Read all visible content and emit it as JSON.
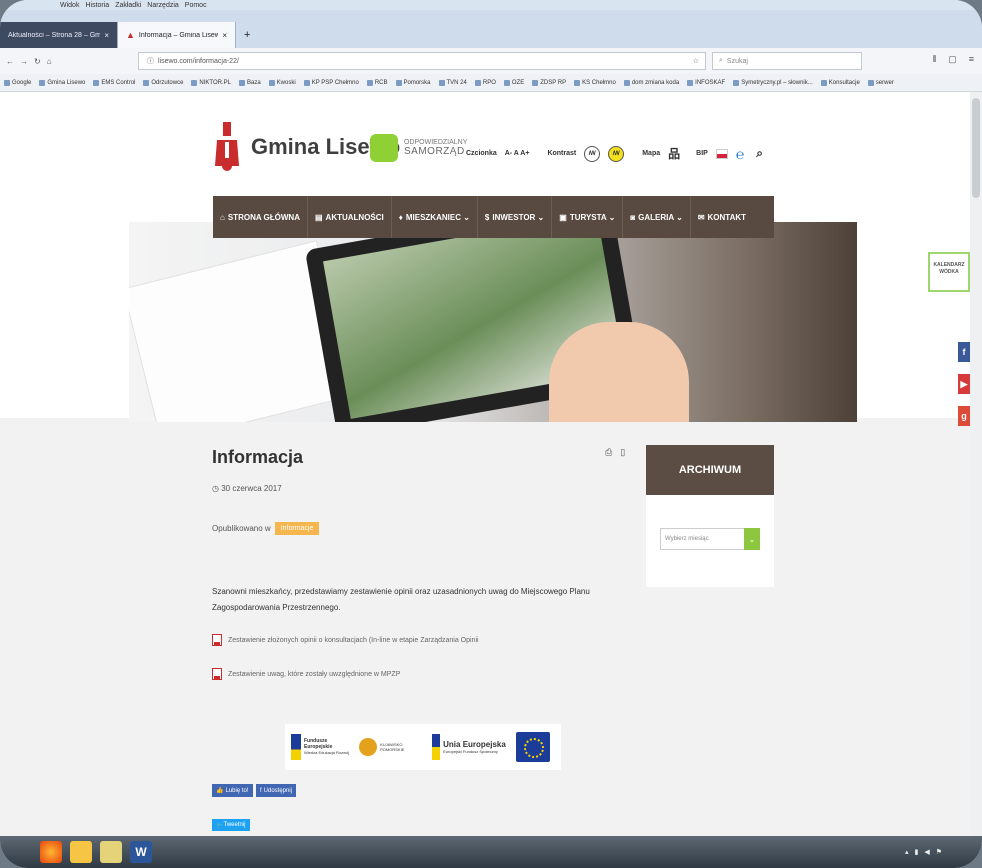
{
  "browser": {
    "menu": [
      "Widok",
      "Historia",
      "Zakładki",
      "Narzędzia",
      "Pomoc"
    ],
    "tabs": [
      {
        "label": "Aktualności – Strona 28 – Gmi...",
        "active": false
      },
      {
        "label": "Informacja – Gmina Lisewo",
        "active": true
      }
    ],
    "url": "lisewo.com/informacja-22/",
    "search_placeholder": "Szukaj",
    "bookmarks": [
      "Google",
      "Gmina Lisewo",
      "EMS Control",
      "Odrzutowce",
      "NIKTOR.PL",
      "Baza",
      "Kwoski",
      "KP PSP Chełmno",
      "RCB",
      "Pomorska",
      "TVN 24",
      "RPO",
      "OZE",
      "ZDSP RP",
      "KS Chełmno",
      "dom zmiana koda",
      "INFOSKAF",
      "Symetryczny.pl – słownik...",
      "Konsultacje",
      "serwer"
    ]
  },
  "site": {
    "title": "Gmina Lisewo",
    "samorzad_small": "ODPOWIEDZIALNY",
    "samorzad_big": "SAMORZĄD",
    "toolbar": {
      "czcionka": "Czcionka",
      "font_sizes": "A- A A+",
      "kontrast": "Kontrast",
      "mapa": "Mapa",
      "bip": "BIP"
    },
    "nav": [
      {
        "icon": "home-icon",
        "label": "STRONA GŁÓWNA"
      },
      {
        "icon": "document-icon",
        "label": "AKTUALNOŚCI"
      },
      {
        "icon": "person-icon",
        "label": "MIESZKANIEC ⌄"
      },
      {
        "icon": "dollar-icon",
        "label": "INWESTOR ⌄"
      },
      {
        "icon": "image-icon",
        "label": "TURYSTA ⌄"
      },
      {
        "icon": "camera-icon",
        "label": "GALERIA ⌄"
      },
      {
        "icon": "mail-icon",
        "label": "KONTAKT"
      }
    ],
    "side_widget": "KALENDARZ WÓDKA"
  },
  "article": {
    "title": "Informacja",
    "date": "30 czerwca 2017",
    "published_in_label": "Opublikowano w",
    "category": "Informacje",
    "body": "Szanowni mieszkańcy, przedstawiamy zestawienie opinii oraz uzasadnionych uwag do Miejscowego Planu Zagospodarowania Przestrzennego.",
    "attachments": [
      "Zestawienie złożonych opinii o konsultacjach (In-line w etapie Zarządzania Opinii",
      "Zestawienie uwag, które zostały uwzględnione w MPZP"
    ]
  },
  "sidebar": {
    "archive_title": "ARCHIWUM",
    "select_placeholder": "Wybierz miesiąc"
  },
  "footer": {
    "eu_logos": {
      "fundusze": "Fundusze Europejskie",
      "fundusze_sub": "Wiedza Edukacja Rozwój",
      "kujawsko": "KUJAWSKO POMORSKIE",
      "unia": "Unia Europejska",
      "unia_sub": "Europejski Fundusz Społeczny"
    },
    "like_label": "Lubię to!",
    "share_label": "Udostępnij",
    "tweet_label": "Tweetnij"
  }
}
